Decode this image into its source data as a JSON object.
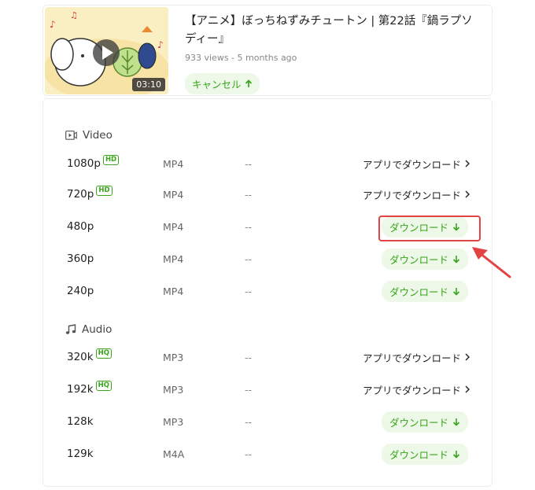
{
  "video": {
    "title": "【アニメ】ぼっちねずみチュートン | 第22話『鍋ラプソディー』",
    "meta": "933 views - 5 months ago",
    "duration": "03:10",
    "cancel_label": "キャンセル"
  },
  "sections": {
    "video_label": "Video",
    "audio_label": "Audio"
  },
  "video_rows": [
    {
      "quality": "1080p",
      "badge": "HD",
      "format": "MP4",
      "size": "--",
      "action": "アプリでダウンロード",
      "action_icon": "chevron-right-icon"
    },
    {
      "quality": "720p",
      "badge": "HD",
      "format": "MP4",
      "size": "--",
      "action": "アプリでダウンロード",
      "action_icon": "chevron-right-icon"
    },
    {
      "quality": "480p",
      "badge": "",
      "format": "MP4",
      "size": "--",
      "action": "ダウンロード",
      "action_icon": "download-arrow-icon"
    },
    {
      "quality": "360p",
      "badge": "",
      "format": "MP4",
      "size": "--",
      "action": "ダウンロード",
      "action_icon": "download-arrow-icon"
    },
    {
      "quality": "240p",
      "badge": "",
      "format": "MP4",
      "size": "--",
      "action": "ダウンロード",
      "action_icon": "download-arrow-icon"
    }
  ],
  "audio_rows": [
    {
      "quality": "320k",
      "badge": "HQ",
      "format": "MP3",
      "size": "--",
      "action": "アプリでダウンロード",
      "action_icon": "chevron-right-icon"
    },
    {
      "quality": "192k",
      "badge": "HQ",
      "format": "MP3",
      "size": "--",
      "action": "アプリでダウンロード",
      "action_icon": "chevron-right-icon"
    },
    {
      "quality": "128k",
      "badge": "",
      "format": "MP3",
      "size": "--",
      "action": "ダウンロード",
      "action_icon": "download-arrow-icon"
    },
    {
      "quality": "129k",
      "badge": "",
      "format": "M4A",
      "size": "--",
      "action": "ダウンロード",
      "action_icon": "download-arrow-icon"
    }
  ],
  "colors": {
    "accent_green": "#38a51b",
    "button_bg": "#eef8e9",
    "annotation_red": "#e34343"
  }
}
